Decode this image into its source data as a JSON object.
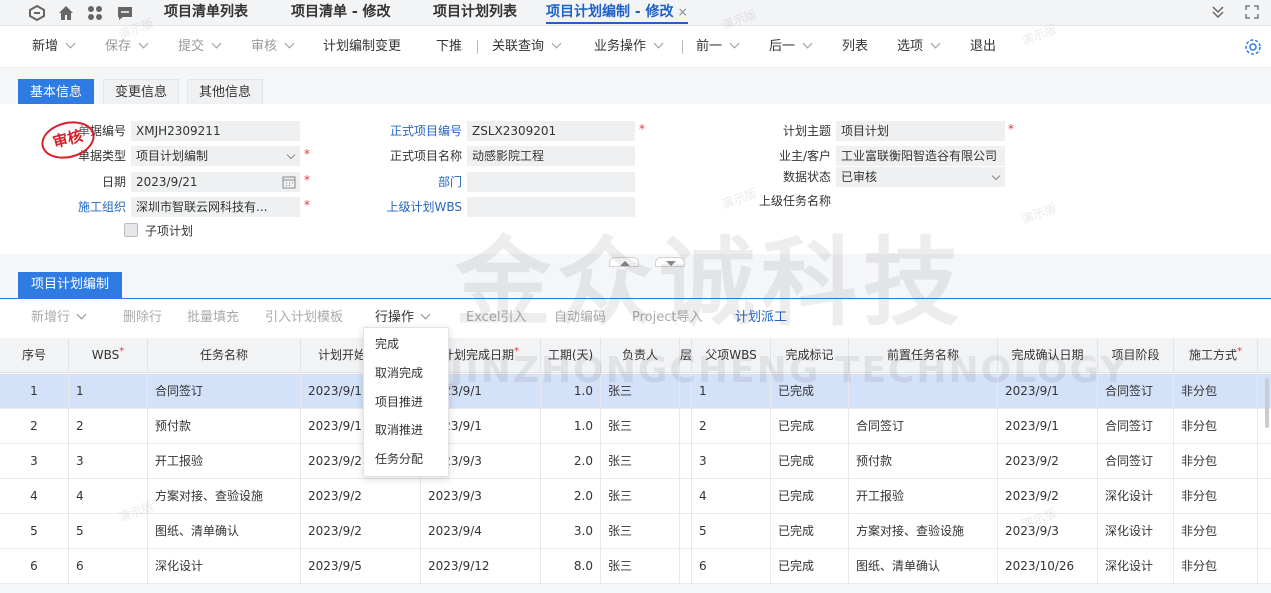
{
  "tabs": [
    {
      "label": "项目清单列表"
    },
    {
      "label": "项目清单 - 修改"
    },
    {
      "label": "项目计划列表"
    },
    {
      "label": "项目计划编制 - 修改",
      "close": "×"
    }
  ],
  "toolbar": {
    "items": [
      "新增",
      "保存",
      "提交",
      "审核",
      "计划编制变更",
      "下推",
      "关联查询",
      "业务操作",
      "前一",
      "后一",
      "列表",
      "选项",
      "退出"
    ]
  },
  "section_tabs": [
    "基本信息",
    "变更信息",
    "其他信息"
  ],
  "form": {
    "doc_no_label": "单据编号",
    "doc_no": "XMJH2309211",
    "doc_type_label": "单据类型",
    "doc_type": "项目计划编制",
    "date_label": "日期",
    "date": "2023/9/21",
    "org_label": "施工组织",
    "org": "深圳市智联云网科技有...",
    "sub_plan_label": "子项计划",
    "formal_no_label": "正式项目编号",
    "formal_no": "ZSLX2309201",
    "formal_name_label": "正式项目名称",
    "formal_name": "动感影院工程",
    "dept_label": "部门",
    "dept": "",
    "parent_wbs_label": "上级计划WBS",
    "parent_wbs": "",
    "plan_subject_label": "计划主题",
    "plan_subject": "项目计划",
    "owner_label": "业主/客户",
    "owner": "工业富联衡阳智造谷有限公司",
    "status_label": "数据状态",
    "status": "已审核",
    "parent_task_label": "上级任务名称",
    "parent_task": ""
  },
  "stamp": "审核",
  "grid": {
    "tab": "项目计划编制",
    "toolbar": [
      "新增行",
      "删除行",
      "批量填充",
      "引入计划模板",
      "行操作",
      "Excel引入",
      "自动编码",
      "Project导入",
      "计划派工"
    ],
    "menu": [
      "完成",
      "取消完成",
      "项目推进",
      "取消推进",
      "任务分配"
    ],
    "columns": [
      "序号",
      "WBS",
      "任务名称",
      "计划开始日期",
      "计划完成日期",
      "工期(天)",
      "负责人",
      "层",
      "父项WBS",
      "完成标记",
      "前置任务名称",
      "完成确认日期",
      "项目阶段",
      "施工方式"
    ],
    "rows": [
      [
        "1",
        "1",
        "合同签订",
        "2023/9/1",
        "2023/9/1",
        "1.0",
        "张三",
        "1",
        "已完成",
        "",
        "2023/9/1",
        "合同签订",
        "非分包"
      ],
      [
        "2",
        "2",
        "预付款",
        "2023/9/1",
        "2023/9/1",
        "1.0",
        "张三",
        "2",
        "已完成",
        "合同签订",
        "2023/9/1",
        "合同签订",
        "非分包"
      ],
      [
        "3",
        "3",
        "开工报验",
        "2023/9/2",
        "2023/9/3",
        "2.0",
        "张三",
        "3",
        "已完成",
        "预付款",
        "2023/9/2",
        "合同签订",
        "非分包"
      ],
      [
        "4",
        "4",
        "方案对接、查验设施",
        "2023/9/2",
        "2023/9/3",
        "2.0",
        "张三",
        "4",
        "已完成",
        "开工报验",
        "2023/9/2",
        "深化设计",
        "非分包"
      ],
      [
        "5",
        "5",
        "图纸、清单确认",
        "2023/9/2",
        "2023/9/4",
        "3.0",
        "张三",
        "5",
        "已完成",
        "方案对接、查验设施",
        "2023/9/3",
        "深化设计",
        "非分包"
      ],
      [
        "6",
        "6",
        "深化设计",
        "2023/9/5",
        "2023/9/12",
        "8.0",
        "张三",
        "6",
        "已完成",
        "图纸、清单确认",
        "2023/10/26",
        "深化设计",
        "非分包"
      ]
    ]
  },
  "watermark": {
    "main": "金众诚科技",
    "sub": "JINZHONGCHENG TECHNOLOGY",
    "demo": "演示版"
  },
  "colors": {
    "accent": "#2d7be3",
    "selected_row": "#d3e1f9",
    "required": "#e53935"
  }
}
